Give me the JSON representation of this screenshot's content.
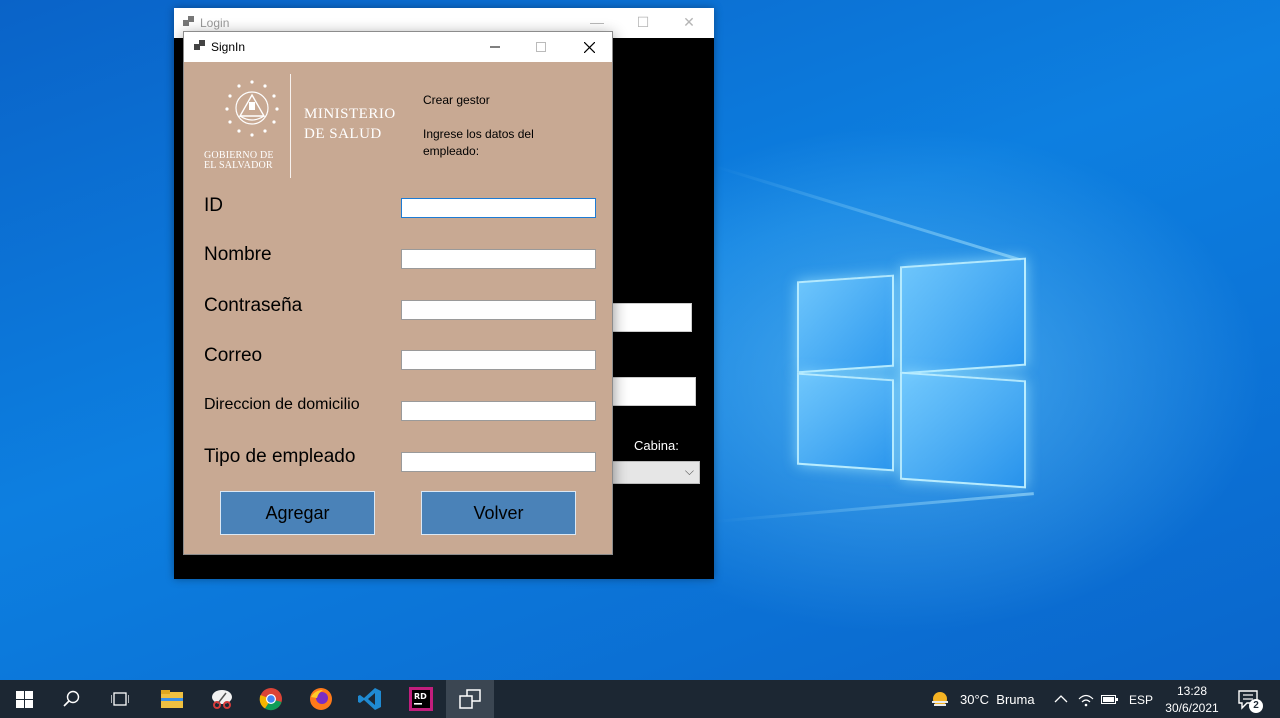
{
  "login_window": {
    "title": "Login",
    "cabina_label": "Cabina:"
  },
  "signin_window": {
    "title": "SignIn",
    "logo": {
      "gobierno_line1": "GOBIERNO DE",
      "gobierno_line2": "EL SALVADOR",
      "ministerio_line1": "MINISTERIO",
      "ministerio_line2": "DE SALUD"
    },
    "header": {
      "title": "Crear gestor",
      "subtitle": "Ingrese los datos del empleado:"
    },
    "fields": [
      {
        "label": "ID",
        "value": ""
      },
      {
        "label": "Nombre",
        "value": ""
      },
      {
        "label": "Contraseña",
        "value": ""
      },
      {
        "label": "Correo",
        "value": ""
      },
      {
        "label": "Direccion de domicilio",
        "value": ""
      },
      {
        "label": "Tipo de empleado",
        "value": ""
      }
    ],
    "buttons": {
      "add": "Agregar",
      "back": "Volver"
    }
  },
  "taskbar": {
    "weather": "30°C  Bruma",
    "language": "ESP",
    "time": "13:28",
    "date": "30/6/2021",
    "notification_count": "2"
  },
  "colors": {
    "form_background": "#c8a993",
    "button": "#4a82b8",
    "taskbar": "#1c2733"
  }
}
